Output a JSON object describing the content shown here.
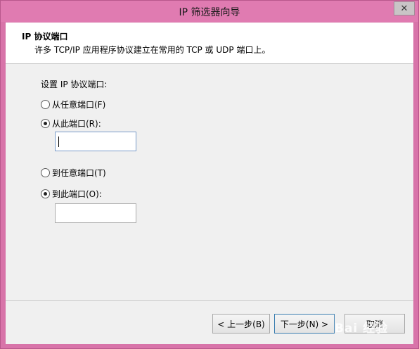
{
  "window": {
    "title": "IP 筛选器向导",
    "close_glyph": "✕"
  },
  "header": {
    "title": "IP 协议端口",
    "subtitle": "许多 TCP/IP 应用程序协议建立在常用的 TCP 或 UDP 端口上。"
  },
  "form": {
    "prompt": "设置 IP 协议端口:",
    "from_any": {
      "label": "从任意端口(F)",
      "checked": false
    },
    "from_this": {
      "label": "从此端口(R):",
      "checked": true,
      "value": ""
    },
    "to_any": {
      "label": "到任意端口(T)",
      "checked": false
    },
    "to_this": {
      "label": "到此端口(O):",
      "checked": true,
      "value": ""
    }
  },
  "buttons": {
    "back": "< 上一步(B)",
    "next": "下一步(N) >",
    "cancel": "取消"
  },
  "watermark": {
    "text": "Bai 经验"
  },
  "colors": {
    "frame": "#d874a9",
    "titlebar": "#e07bb1",
    "client": "#f0f0f0",
    "focus_border": "#7a9cc9"
  }
}
